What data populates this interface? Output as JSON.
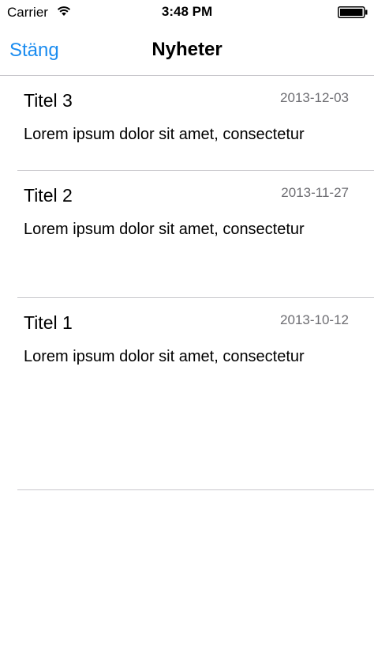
{
  "status_bar": {
    "carrier": "Carrier",
    "time": "3:48 PM"
  },
  "nav": {
    "close_label": "Stäng",
    "title": "Nyheter"
  },
  "news": [
    {
      "title": "Titel 3",
      "date": "2013-12-03",
      "body": "Lorem ipsum dolor sit amet, consectetur"
    },
    {
      "title": "Titel 2",
      "date": "2013-11-27",
      "body": "Lorem ipsum dolor sit amet, consectetur"
    },
    {
      "title": "Titel 1",
      "date": "2013-10-12",
      "body": "Lorem ipsum dolor sit amet, consectetur"
    }
  ],
  "colors": {
    "accent": "#1a8cf0",
    "separator": "#c8c7cc",
    "date_text": "#6d6d72"
  },
  "icons": [
    "wifi-icon",
    "battery-icon"
  ]
}
